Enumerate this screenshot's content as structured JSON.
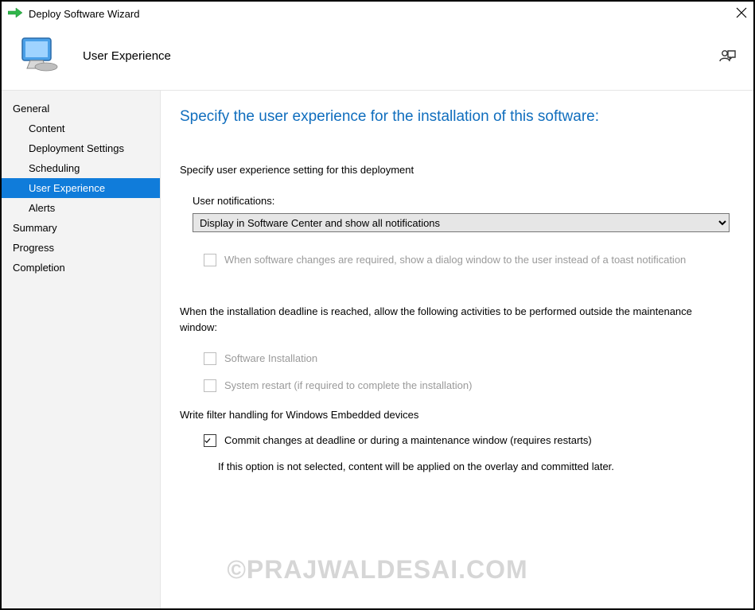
{
  "window": {
    "title": "Deploy Software Wizard"
  },
  "header": {
    "page_name": "User Experience"
  },
  "sidebar": {
    "items": [
      {
        "label": "General",
        "sub": false,
        "selected": false
      },
      {
        "label": "Content",
        "sub": true,
        "selected": false
      },
      {
        "label": "Deployment Settings",
        "sub": true,
        "selected": false
      },
      {
        "label": "Scheduling",
        "sub": true,
        "selected": false
      },
      {
        "label": "User Experience",
        "sub": true,
        "selected": true
      },
      {
        "label": "Alerts",
        "sub": true,
        "selected": false
      },
      {
        "label": "Summary",
        "sub": false,
        "selected": false
      },
      {
        "label": "Progress",
        "sub": false,
        "selected": false
      },
      {
        "label": "Completion",
        "sub": false,
        "selected": false
      }
    ]
  },
  "main": {
    "heading": "Specify the user experience for the installation of this software:",
    "intro": "Specify user experience setting for this deployment",
    "notifications": {
      "label": "User notifications:",
      "selected": "Display in Software Center and show all notifications"
    },
    "dialog_checkbox": {
      "label": "When software changes are required, show a dialog window to the user instead of a toast notification",
      "checked": false,
      "enabled": false
    },
    "deadline_group": {
      "label": "When the installation deadline is reached, allow the following activities to be performed outside the maintenance window:",
      "software_install": {
        "label": "Software Installation",
        "checked": false,
        "enabled": false
      },
      "system_restart": {
        "label": "System restart  (if required to complete the installation)",
        "checked": false,
        "enabled": false
      }
    },
    "embedded_group": {
      "label": "Write filter handling for Windows Embedded devices",
      "commit_checkbox": {
        "label": "Commit changes at deadline or during a maintenance window (requires restarts)",
        "checked": true,
        "enabled": true
      },
      "help": "If this option is not selected, content will be applied on the overlay and committed later."
    }
  },
  "watermark": "©PRAJWALDESAI.COM"
}
